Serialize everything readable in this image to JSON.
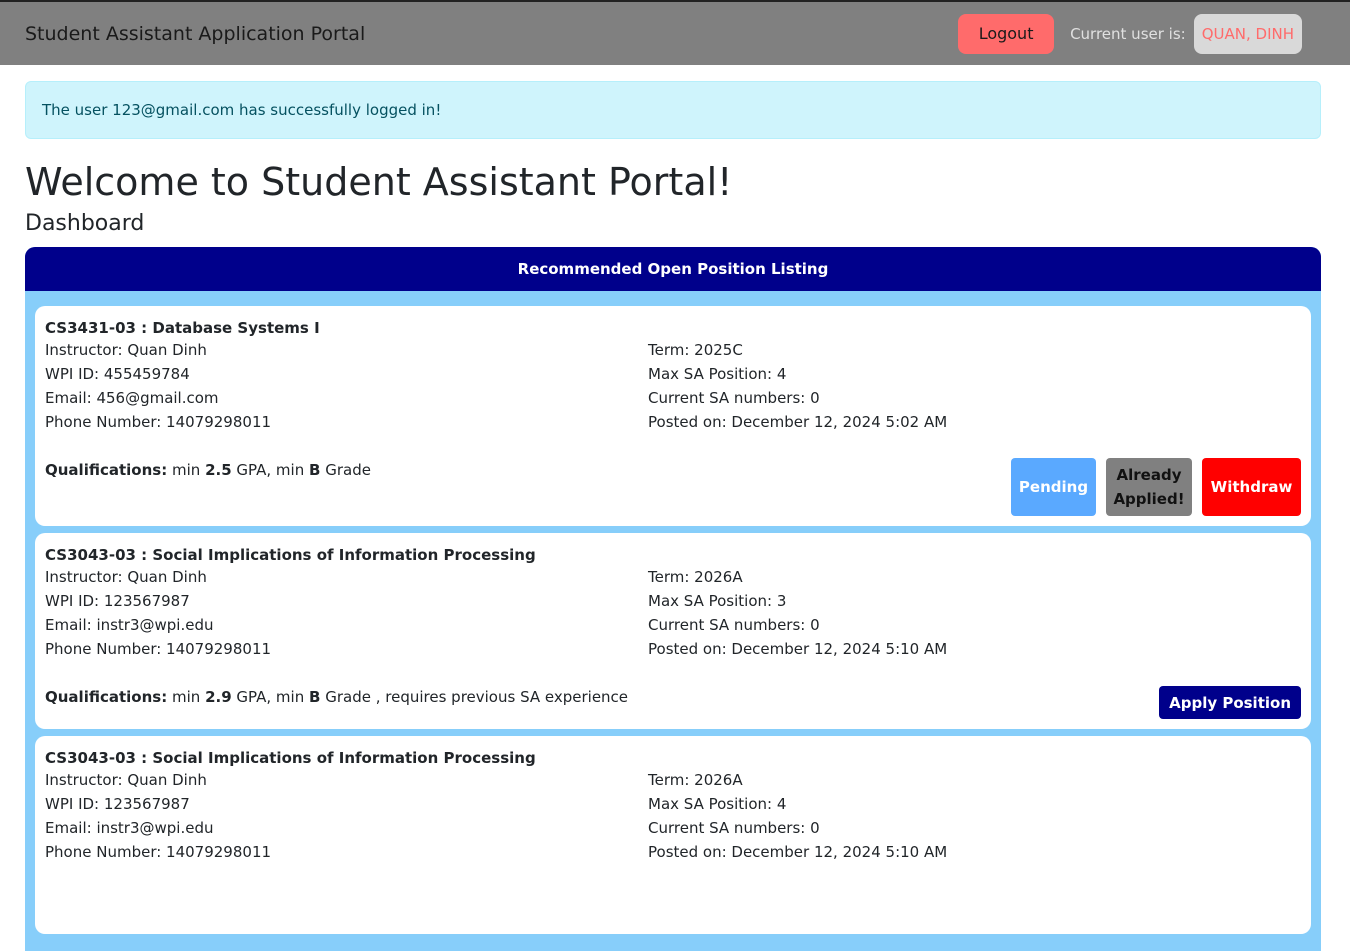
{
  "header": {
    "title": "Student Assistant Application Portal",
    "logout": "Logout",
    "current_user_label": "Current user is:",
    "current_user": "QUAN, DINH"
  },
  "alert": "The user 123@gmail.com has successfully logged in!",
  "heading": "Welcome to Student Assistant Portal!",
  "subheading": "Dashboard",
  "panel": {
    "title": "Recommended Open Position Listing"
  },
  "cards": [
    {
      "title": "CS3431-03 : Database Systems I",
      "instructor": "Instructor: Quan Dinh",
      "wpi": "WPI ID: 455459784",
      "email": "Email: 456@gmail.com",
      "phone": "Phone Number: 14079298011",
      "term": "Term: 2025C",
      "max": "Max SA Position: 4",
      "current": "Current SA numbers: 0",
      "posted": "Posted on: December 12, 2024 5:02 AM",
      "q_label": "Qualifications:",
      "q_min1": "min",
      "gpa": "2.5",
      "q_mid": "GPA, min",
      "grade": "B",
      "q_end": "Grade",
      "buttons": {
        "pending": "Pending",
        "applied": "Already Applied!",
        "withdraw": "Withdraw"
      }
    },
    {
      "title": "CS3043-03 : Social Implications of Information Processing",
      "instructor": "Instructor: Quan Dinh",
      "wpi": "WPI ID: 123567987",
      "email": "Email: instr3@wpi.edu",
      "phone": "Phone Number: 14079298011",
      "term": "Term: 2026A",
      "max": "Max SA Position: 3",
      "current": "Current SA numbers: 0",
      "posted": "Posted on: December 12, 2024 5:10 AM",
      "q_label": "Qualifications:",
      "q_min1": "min",
      "gpa": "2.9",
      "q_mid": "GPA, min",
      "grade": "B",
      "q_end": "Grade , requires previous SA experience",
      "buttons": {
        "apply": "Apply Position"
      }
    },
    {
      "title": "CS3043-03 : Social Implications of Information Processing",
      "instructor": "Instructor: Quan Dinh",
      "wpi": "WPI ID: 123567987",
      "email": "Email: instr3@wpi.edu",
      "phone": "Phone Number: 14079298011",
      "term": "Term: 2026A",
      "max": "Max SA Position: 4",
      "current": "Current SA numbers: 0",
      "posted": "Posted on: December 12, 2024 5:10 AM"
    }
  ]
}
